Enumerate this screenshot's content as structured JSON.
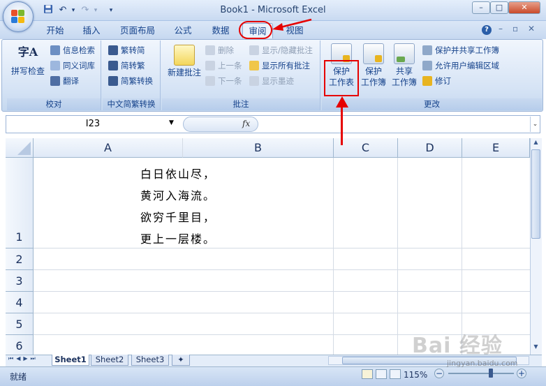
{
  "window": {
    "title": "Book1 - Microsoft Excel",
    "min_glyph": "–",
    "max_glyph": "□",
    "close_glyph": "✕"
  },
  "quick_access": {
    "undo_glyph": "↶",
    "redo_glyph": "↷",
    "more_glyph": "▾"
  },
  "tabs": [
    {
      "label": "开始"
    },
    {
      "label": "插入"
    },
    {
      "label": "页面布局"
    },
    {
      "label": "公式"
    },
    {
      "label": "数据"
    },
    {
      "label": "审阅"
    },
    {
      "label": "视图"
    }
  ],
  "ribbon_right": {
    "help": "?",
    "min": "–",
    "restore": "▫",
    "close": "✕"
  },
  "groups": {
    "proofing": {
      "label": "校对",
      "spell": "拼写检查",
      "research": "信息检索",
      "thesaurus": "同义词库",
      "translate": "翻译",
      "spell_icon_text": "字A"
    },
    "chinese": {
      "label": "中文简繁转换",
      "to_trad": "繁转简",
      "to_simp": "简转繁",
      "convert": "简繁转换"
    },
    "comments": {
      "label": "批注",
      "new_l1": "新建批注",
      "delete": "删除",
      "prev": "上一条",
      "next": "下一条",
      "show_hide": "显示/隐藏批注",
      "show_all": "显示所有批注",
      "show_ink": "显示墨迹"
    },
    "changes": {
      "label": "更改",
      "protect_sheet_l1": "保护",
      "protect_sheet_l2": "工作表",
      "protect_book_l1": "保护",
      "protect_book_l2": "工作簿",
      "share_l1": "共享",
      "share_l2": "工作簿",
      "protect_share": "保护并共享工作簿",
      "allow_edit": "允许用户编辑区域",
      "track": "修订"
    }
  },
  "formula_bar": {
    "name_box": "I23",
    "fx": "fx",
    "formula": ""
  },
  "columns": [
    "A",
    "B",
    "C",
    "D",
    "E"
  ],
  "rows": [
    "1",
    "2",
    "3",
    "4",
    "5",
    "6"
  ],
  "cells": {
    "A1_lines": [
      "白日依山尽，",
      "黄河入海流。",
      "欲穷千里目，",
      "更上一层楼。"
    ]
  },
  "sheets": [
    "Sheet1",
    "Sheet2",
    "Sheet3"
  ],
  "status": {
    "ready": "就绪",
    "zoom": "115%",
    "minus": "−",
    "plus": "+"
  },
  "watermark": {
    "text": "Bai 经验",
    "sub": "jingyan.baidu.com"
  },
  "colors": {
    "annotation": "#e60000",
    "accent": "#15428b"
  }
}
